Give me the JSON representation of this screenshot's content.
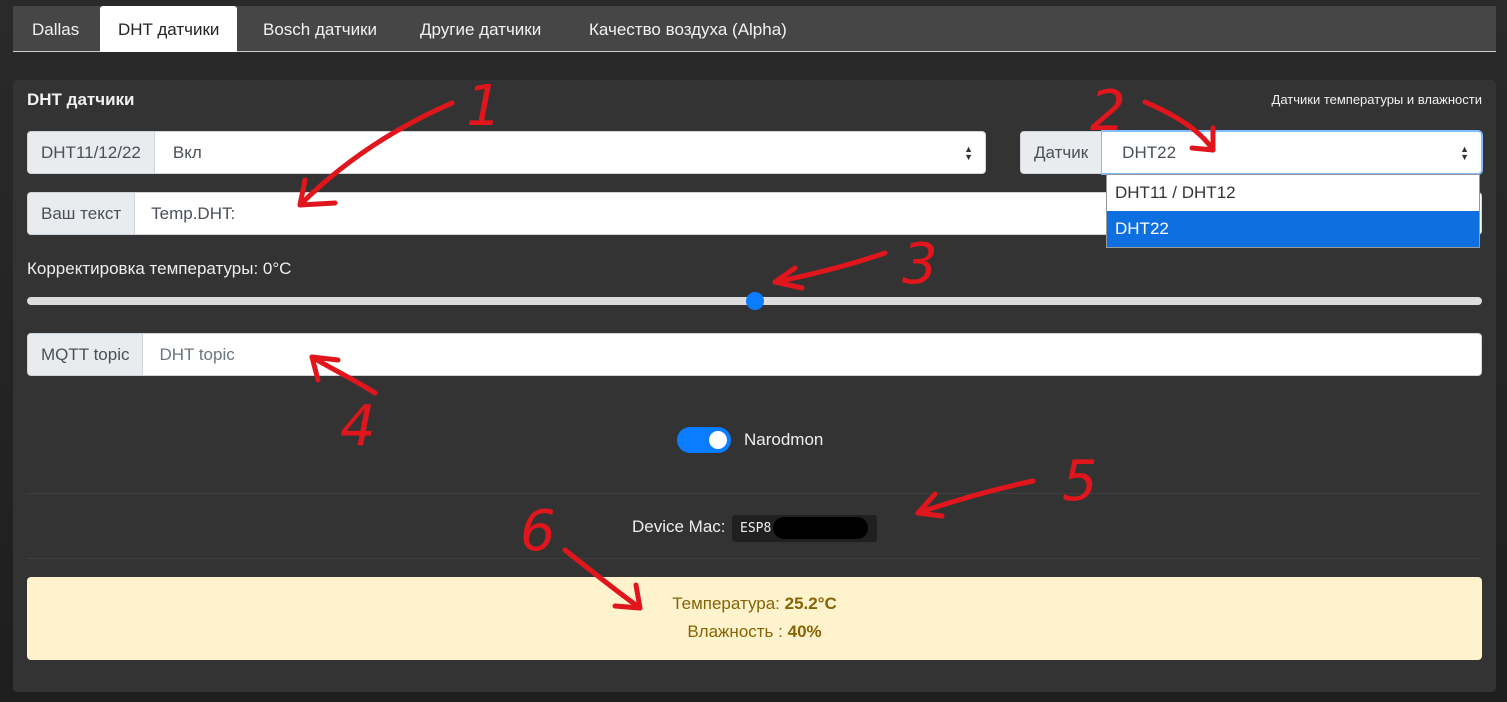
{
  "tabs": [
    {
      "label": "Dallas"
    },
    {
      "label": "DHT датчики"
    },
    {
      "label": "Bosch датчики"
    },
    {
      "label": "Другие датчики"
    },
    {
      "label": "Качество воздуха (Alpha)"
    }
  ],
  "card": {
    "title": "DHT датчики",
    "subtitle": "Датчики температуры и влажности"
  },
  "dht_enable": {
    "label": "DHT11/12/22",
    "value": "Вкл"
  },
  "sensor": {
    "label": "Датчик",
    "value": "DHT22",
    "options": [
      "DHT11 / DHT12",
      "DHT22"
    ]
  },
  "custom_text": {
    "label": "Ваш текст",
    "value": "Temp.DHT:"
  },
  "temp_correction": {
    "label": "Корректировка температуры: 0°C",
    "value": 0
  },
  "mqtt": {
    "label": "MQTT topic",
    "placeholder": "DHT topic"
  },
  "narodmon": {
    "label": "Narodmon",
    "enabled": true
  },
  "device_mac": {
    "label": "Device Mac:",
    "value": "ESP8"
  },
  "readings": {
    "temperature_label": "Температура:",
    "temperature_value": "25.2°C",
    "humidity_label": "Влажность :",
    "humidity_value": "40%"
  },
  "annotations": [
    "1",
    "2",
    "3",
    "4",
    "5",
    "6"
  ],
  "colors": {
    "accent": "#0a7cff",
    "annotation": "#e0161c",
    "alert_bg": "#fff3cd",
    "alert_text": "#856404"
  }
}
